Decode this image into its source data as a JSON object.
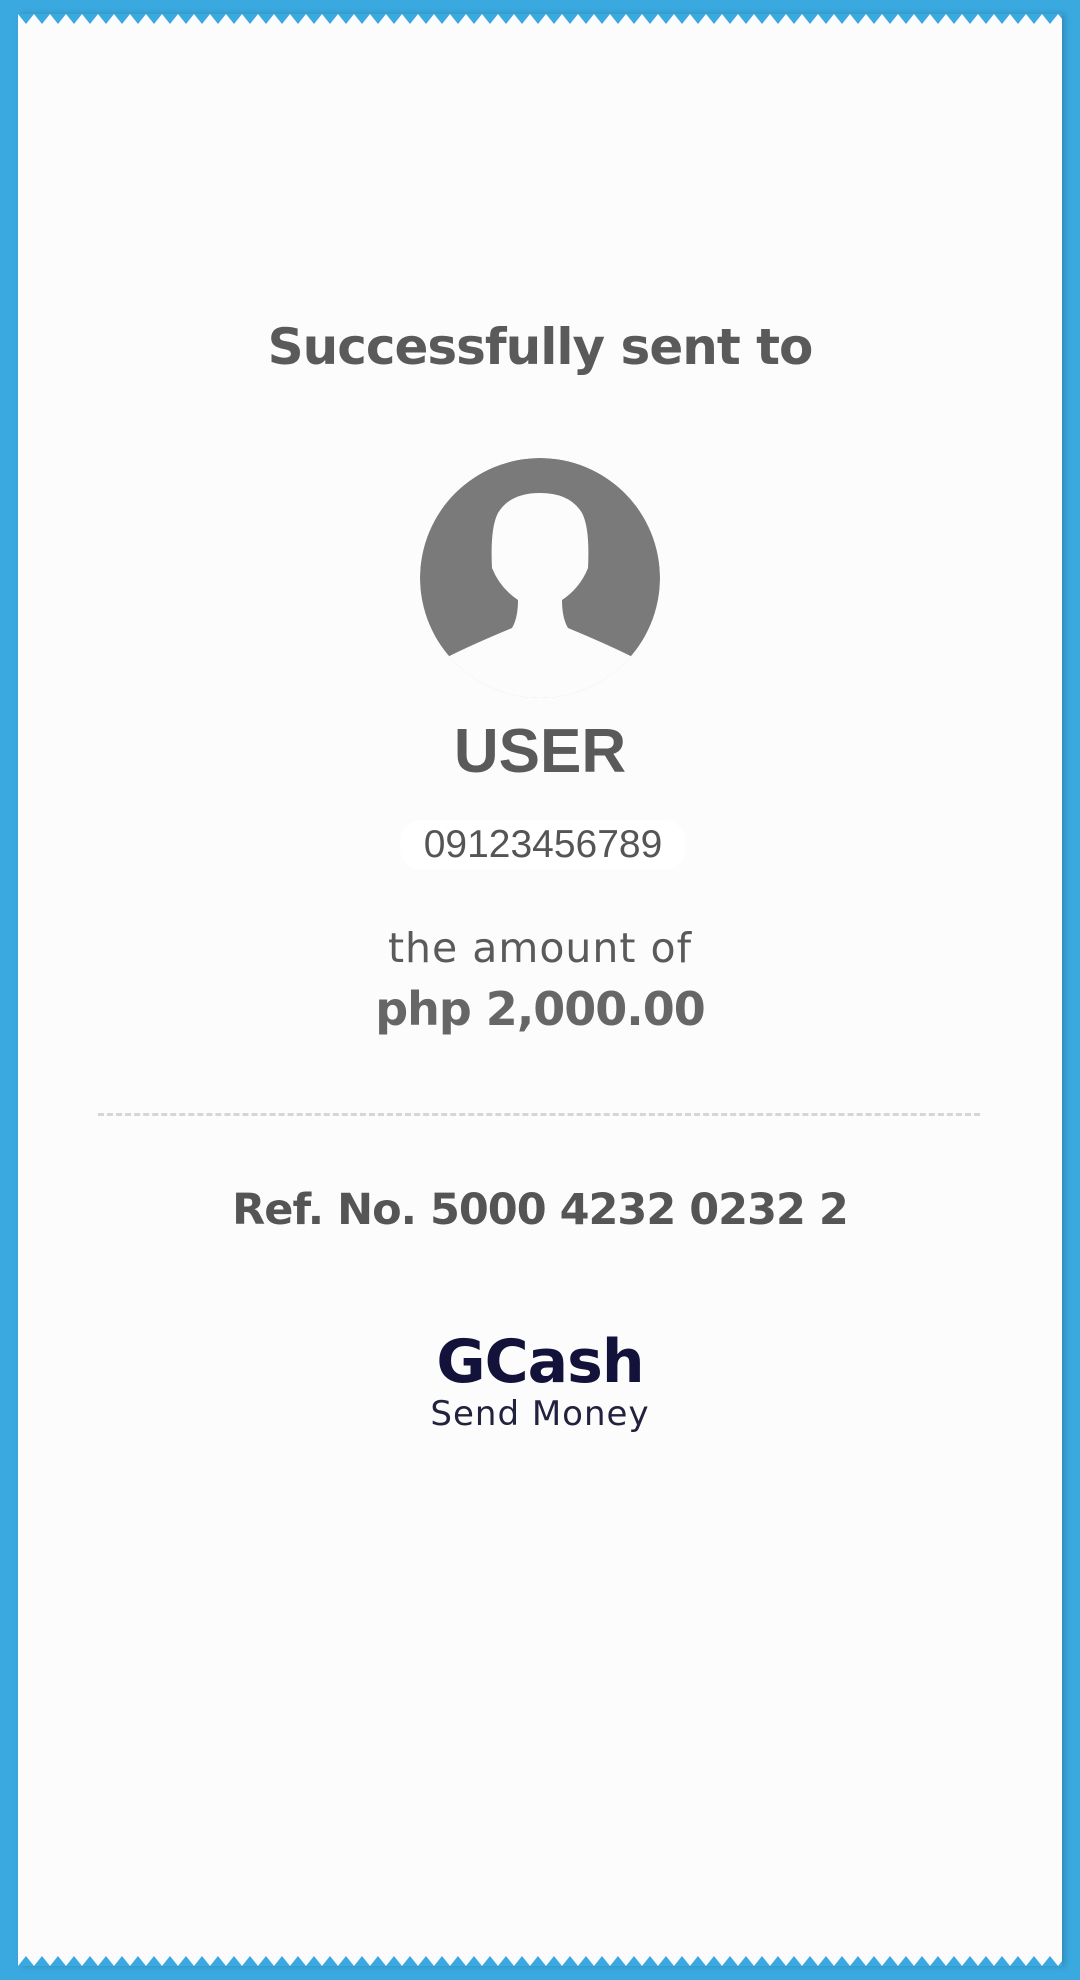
{
  "receipt": {
    "title": "Successfully sent to",
    "recipient": {
      "avatar_icon": "user-silhouette-icon",
      "name": "USER",
      "phone": "09123456789"
    },
    "amount_label": "the amount of",
    "amount": "php 2,000.00",
    "reference": "Ref. No. 5000 4232 0232 2",
    "brand": {
      "logo_text": "GCash",
      "subtitle": "Send Money"
    }
  },
  "colors": {
    "background": "#3aa9e0",
    "paper": "#fcfcfc",
    "text_gray": "#5a5a5a",
    "brand_navy": "#12123a",
    "avatar_gray": "#7a7a7a"
  }
}
